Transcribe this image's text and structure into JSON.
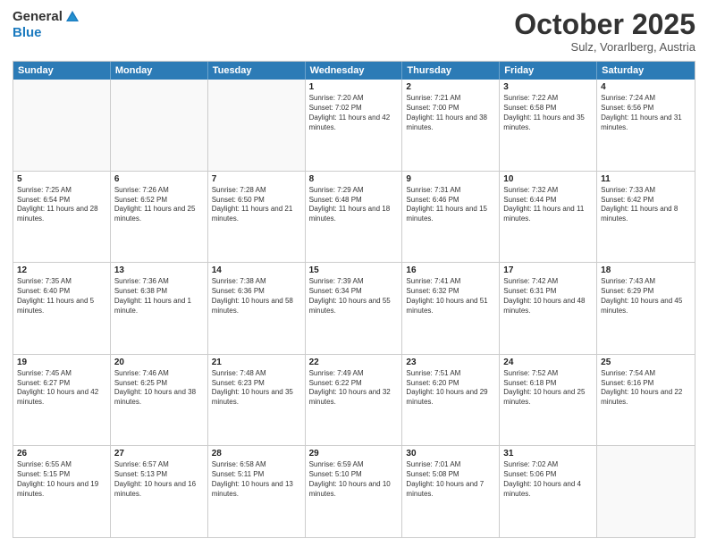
{
  "header": {
    "logo_general": "General",
    "logo_blue": "Blue",
    "title": "October 2025",
    "location": "Sulz, Vorarlberg, Austria"
  },
  "calendar": {
    "days": [
      "Sunday",
      "Monday",
      "Tuesday",
      "Wednesday",
      "Thursday",
      "Friday",
      "Saturday"
    ],
    "rows": [
      [
        {
          "day": "",
          "empty": true
        },
        {
          "day": "",
          "empty": true
        },
        {
          "day": "",
          "empty": true
        },
        {
          "day": "1",
          "sunrise": "7:20 AM",
          "sunset": "7:02 PM",
          "daylight": "11 hours and 42 minutes."
        },
        {
          "day": "2",
          "sunrise": "7:21 AM",
          "sunset": "7:00 PM",
          "daylight": "11 hours and 38 minutes."
        },
        {
          "day": "3",
          "sunrise": "7:22 AM",
          "sunset": "6:58 PM",
          "daylight": "11 hours and 35 minutes."
        },
        {
          "day": "4",
          "sunrise": "7:24 AM",
          "sunset": "6:56 PM",
          "daylight": "11 hours and 31 minutes."
        }
      ],
      [
        {
          "day": "5",
          "sunrise": "7:25 AM",
          "sunset": "6:54 PM",
          "daylight": "11 hours and 28 minutes."
        },
        {
          "day": "6",
          "sunrise": "7:26 AM",
          "sunset": "6:52 PM",
          "daylight": "11 hours and 25 minutes."
        },
        {
          "day": "7",
          "sunrise": "7:28 AM",
          "sunset": "6:50 PM",
          "daylight": "11 hours and 21 minutes."
        },
        {
          "day": "8",
          "sunrise": "7:29 AM",
          "sunset": "6:48 PM",
          "daylight": "11 hours and 18 minutes."
        },
        {
          "day": "9",
          "sunrise": "7:31 AM",
          "sunset": "6:46 PM",
          "daylight": "11 hours and 15 minutes."
        },
        {
          "day": "10",
          "sunrise": "7:32 AM",
          "sunset": "6:44 PM",
          "daylight": "11 hours and 11 minutes."
        },
        {
          "day": "11",
          "sunrise": "7:33 AM",
          "sunset": "6:42 PM",
          "daylight": "11 hours and 8 minutes."
        }
      ],
      [
        {
          "day": "12",
          "sunrise": "7:35 AM",
          "sunset": "6:40 PM",
          "daylight": "11 hours and 5 minutes."
        },
        {
          "day": "13",
          "sunrise": "7:36 AM",
          "sunset": "6:38 PM",
          "daylight": "11 hours and 1 minute."
        },
        {
          "day": "14",
          "sunrise": "7:38 AM",
          "sunset": "6:36 PM",
          "daylight": "10 hours and 58 minutes."
        },
        {
          "day": "15",
          "sunrise": "7:39 AM",
          "sunset": "6:34 PM",
          "daylight": "10 hours and 55 minutes."
        },
        {
          "day": "16",
          "sunrise": "7:41 AM",
          "sunset": "6:32 PM",
          "daylight": "10 hours and 51 minutes."
        },
        {
          "day": "17",
          "sunrise": "7:42 AM",
          "sunset": "6:31 PM",
          "daylight": "10 hours and 48 minutes."
        },
        {
          "day": "18",
          "sunrise": "7:43 AM",
          "sunset": "6:29 PM",
          "daylight": "10 hours and 45 minutes."
        }
      ],
      [
        {
          "day": "19",
          "sunrise": "7:45 AM",
          "sunset": "6:27 PM",
          "daylight": "10 hours and 42 minutes."
        },
        {
          "day": "20",
          "sunrise": "7:46 AM",
          "sunset": "6:25 PM",
          "daylight": "10 hours and 38 minutes."
        },
        {
          "day": "21",
          "sunrise": "7:48 AM",
          "sunset": "6:23 PM",
          "daylight": "10 hours and 35 minutes."
        },
        {
          "day": "22",
          "sunrise": "7:49 AM",
          "sunset": "6:22 PM",
          "daylight": "10 hours and 32 minutes."
        },
        {
          "day": "23",
          "sunrise": "7:51 AM",
          "sunset": "6:20 PM",
          "daylight": "10 hours and 29 minutes."
        },
        {
          "day": "24",
          "sunrise": "7:52 AM",
          "sunset": "6:18 PM",
          "daylight": "10 hours and 25 minutes."
        },
        {
          "day": "25",
          "sunrise": "7:54 AM",
          "sunset": "6:16 PM",
          "daylight": "10 hours and 22 minutes."
        }
      ],
      [
        {
          "day": "26",
          "sunrise": "6:55 AM",
          "sunset": "5:15 PM",
          "daylight": "10 hours and 19 minutes."
        },
        {
          "day": "27",
          "sunrise": "6:57 AM",
          "sunset": "5:13 PM",
          "daylight": "10 hours and 16 minutes."
        },
        {
          "day": "28",
          "sunrise": "6:58 AM",
          "sunset": "5:11 PM",
          "daylight": "10 hours and 13 minutes."
        },
        {
          "day": "29",
          "sunrise": "6:59 AM",
          "sunset": "5:10 PM",
          "daylight": "10 hours and 10 minutes."
        },
        {
          "day": "30",
          "sunrise": "7:01 AM",
          "sunset": "5:08 PM",
          "daylight": "10 hours and 7 minutes."
        },
        {
          "day": "31",
          "sunrise": "7:02 AM",
          "sunset": "5:06 PM",
          "daylight": "10 hours and 4 minutes."
        },
        {
          "day": "",
          "empty": true
        }
      ]
    ]
  }
}
